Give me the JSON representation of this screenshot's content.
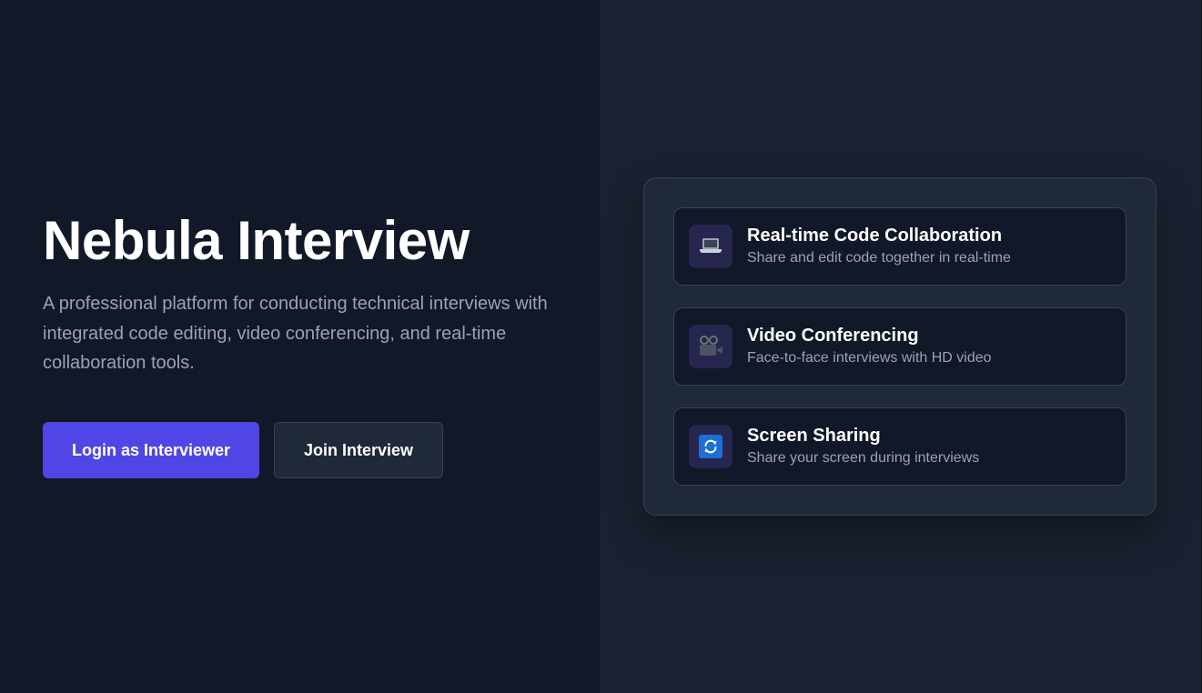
{
  "hero": {
    "title": "Nebula Interview",
    "description": "A professional platform for conducting technical interviews with integrated code editing, video conferencing, and real-time collaboration tools.",
    "primary_button": "Login as Interviewer",
    "secondary_button": "Join Interview"
  },
  "features": [
    {
      "icon": "laptop-icon",
      "title": "Real-time Code Collaboration",
      "description": "Share and edit code together in real-time"
    },
    {
      "icon": "movie-camera-icon",
      "title": "Video Conferencing",
      "description": "Face-to-face interviews with HD video"
    },
    {
      "icon": "sync-arrows-icon",
      "title": "Screen Sharing",
      "description": "Share your screen during interviews"
    }
  ],
  "colors": {
    "left_background": "#111827",
    "right_background": "#1a2130",
    "primary_accent": "#4f46e5",
    "card_background": "#111827",
    "panel_background": "#1f2937",
    "muted_text": "#9ca3af"
  }
}
